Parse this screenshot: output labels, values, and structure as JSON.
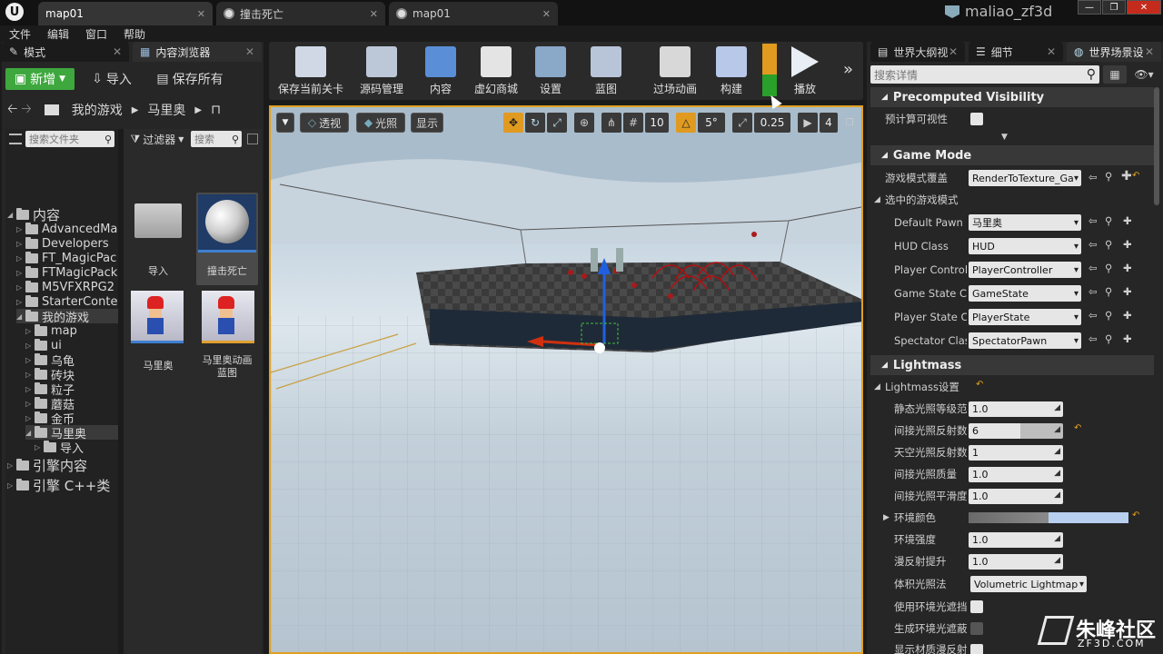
{
  "window": {
    "tabs": [
      "map01",
      "撞击死亡",
      "map01"
    ],
    "user": "maliao_zf3d"
  },
  "menu": [
    "文件",
    "编辑",
    "窗口",
    "帮助"
  ],
  "left_tabs": {
    "modes": "模式",
    "content_browser": "内容浏览器"
  },
  "cb_toolbar": {
    "add": "新增",
    "import": "导入",
    "save_all": "保存所有"
  },
  "breadcrumb": [
    "我的游戏",
    "马里奥"
  ],
  "search": {
    "folders_placeholder": "搜索文件夹",
    "filter": "过滤器",
    "assets_placeholder": "搜索"
  },
  "tree": [
    {
      "label": "内容",
      "level": 0,
      "open": true
    },
    {
      "label": "AdvancedMag",
      "level": 1
    },
    {
      "label": "Developers",
      "level": 1
    },
    {
      "label": "FT_MagicPac",
      "level": 1
    },
    {
      "label": "FTMagicPack",
      "level": 1
    },
    {
      "label": "M5VFXRPG2",
      "level": 1
    },
    {
      "label": "StarterConten",
      "level": 1
    },
    {
      "label": "我的游戏",
      "level": 1,
      "open": true
    },
    {
      "label": "map",
      "level": 2
    },
    {
      "label": "ui",
      "level": 2
    },
    {
      "label": "乌龟",
      "level": 2
    },
    {
      "label": "砖块",
      "level": 2
    },
    {
      "label": "粒子",
      "level": 2
    },
    {
      "label": "蘑菇",
      "level": 2
    },
    {
      "label": "金币",
      "level": 2
    },
    {
      "label": "马里奥",
      "level": 2,
      "open": true
    },
    {
      "label": "导入",
      "level": 3
    },
    {
      "label": "引擎内容",
      "level": 0
    },
    {
      "label": "引擎 C++类",
      "level": 0
    }
  ],
  "assets": [
    {
      "label": "导入",
      "type": "folder"
    },
    {
      "label": "撞击死亡",
      "type": "sphere",
      "selected": true
    },
    {
      "label": "马里奥",
      "type": "mario"
    },
    {
      "label": "马里奥动画\n蓝图",
      "type": "mario-bp"
    }
  ],
  "toolbar": [
    {
      "label": "保存当前关卡",
      "icon": "save-icon"
    },
    {
      "label": "源码管理",
      "icon": "source-control-icon"
    },
    {
      "label": "内容",
      "icon": "content-icon"
    },
    {
      "label": "虚幻商城",
      "icon": "marketplace-icon"
    },
    {
      "label": "设置",
      "icon": "settings-icon"
    },
    {
      "label": "蓝图",
      "icon": "blueprint-icon"
    },
    {
      "label": "过场动画",
      "icon": "cinematics-icon"
    },
    {
      "label": "构建",
      "icon": "build-icon"
    },
    {
      "label": "播放",
      "icon": "play-icon"
    }
  ],
  "viewport": {
    "perspective": "透视",
    "lit": "光照",
    "show": "显示",
    "grid": "10",
    "angle": "5°",
    "scale": "0.25",
    "camspeed": "4"
  },
  "right_tabs": [
    "世界大纲视",
    "细节",
    "世界场景设"
  ],
  "details": {
    "search_placeholder": "搜索详情",
    "sec_precomputed": "Precomputed Visibility",
    "precomputed_label": "预计算可视性",
    "sec_gamemode": "Game Mode",
    "gm_override_label": "游戏模式覆盖",
    "gm_override_value": "RenderToTexture_Ga",
    "selected_gm": "选中的游戏模式",
    "gm_rows": [
      {
        "label": "Default Pawn Cl",
        "value": "马里奥"
      },
      {
        "label": "HUD Class",
        "value": "HUD"
      },
      {
        "label": "Player Controlle",
        "value": "PlayerController"
      },
      {
        "label": "Game State Cla",
        "value": "GameState"
      },
      {
        "label": "Player State Cla",
        "value": "PlayerState"
      },
      {
        "label": "Spectator Class",
        "value": "SpectatorPawn"
      }
    ],
    "sec_lightmass": "Lightmass",
    "lightmass_settings": "Lightmass设置",
    "lm_rows": [
      {
        "label": "静态光照等级范围",
        "value": "1.0"
      },
      {
        "label": "间接光照反射数",
        "value": "6"
      },
      {
        "label": "天空光照反射数",
        "value": "1"
      },
      {
        "label": "间接光照质量",
        "value": "1.0"
      },
      {
        "label": "间接光照平滑度",
        "value": "1.0"
      }
    ],
    "env_color": "环境颜色",
    "lm_rows2": [
      {
        "label": "环境强度",
        "value": "1.0"
      },
      {
        "label": "漫反射提升",
        "value": "1.0"
      }
    ],
    "volumetric_label": "体积光照法",
    "volumetric_value": "Volumetric Lightmap",
    "use_ao": "使用环境光遮挡",
    "gen_ao": "生成环境光遮蔽",
    "show_diffuse": "显示材质漫反射"
  },
  "watermark": {
    "title": "朱峰社区",
    "sub": "ZF3D.COM"
  }
}
